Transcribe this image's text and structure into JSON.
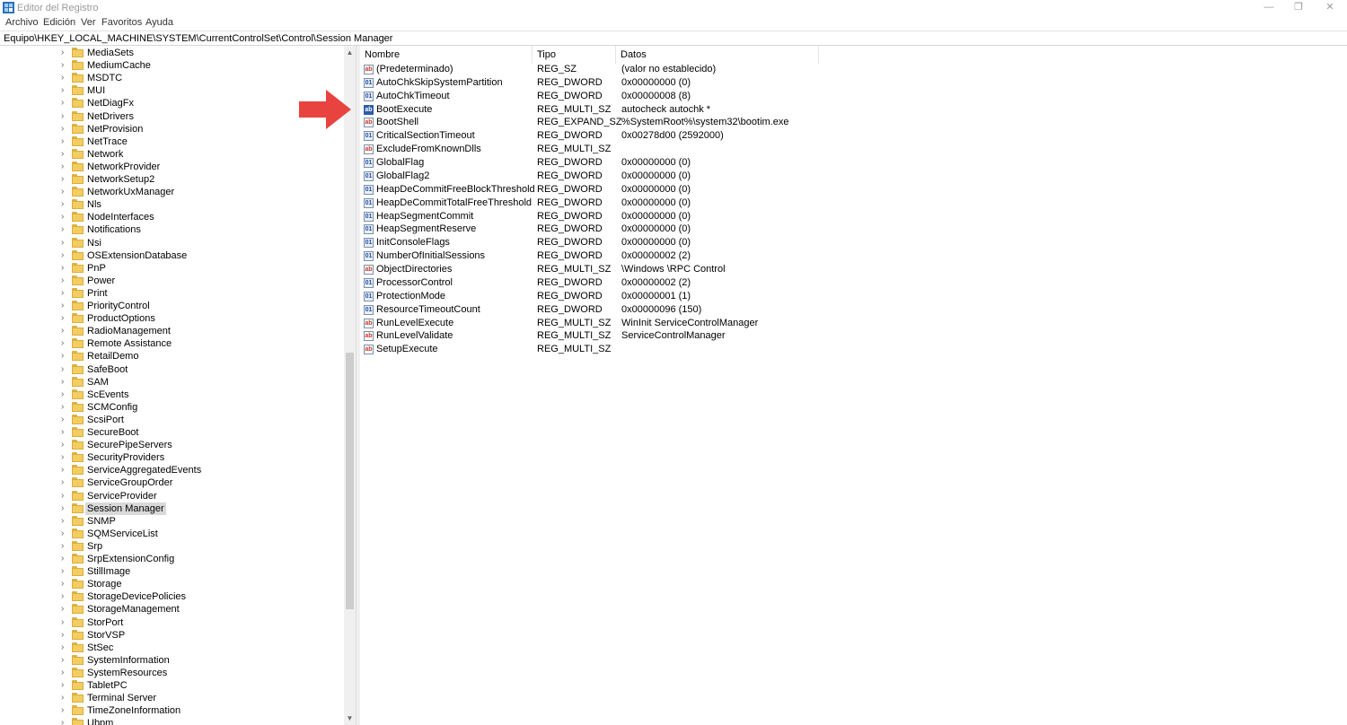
{
  "window": {
    "title": "Editor del Registro",
    "minimize_glyph": "—",
    "maximize_glyph": "❐",
    "close_glyph": "✕"
  },
  "menu": [
    "Archivo",
    "Edición",
    "Ver",
    "Favoritos",
    "Ayuda"
  ],
  "address": "Equipo\\HKEY_LOCAL_MACHINE\\SYSTEM\\CurrentControlSet\\Control\\Session Manager",
  "tree": {
    "selected": "Session Manager",
    "chevron_glyph": "›",
    "items": [
      "MediaSets",
      "MediumCache",
      "MSDTC",
      "MUI",
      "NetDiagFx",
      "NetDrivers",
      "NetProvision",
      "NetTrace",
      "Network",
      "NetworkProvider",
      "NetworkSetup2",
      "NetworkUxManager",
      "Nls",
      "NodeInterfaces",
      "Notifications",
      "Nsi",
      "OSExtensionDatabase",
      "PnP",
      "Power",
      "Print",
      "PriorityControl",
      "ProductOptions",
      "RadioManagement",
      "Remote Assistance",
      "RetailDemo",
      "SafeBoot",
      "SAM",
      "ScEvents",
      "SCMConfig",
      "ScsiPort",
      "SecureBoot",
      "SecurePipeServers",
      "SecurityProviders",
      "ServiceAggregatedEvents",
      "ServiceGroupOrder",
      "ServiceProvider",
      "Session Manager",
      "SNMP",
      "SQMServiceList",
      "Srp",
      "SrpExtensionConfig",
      "StillImage",
      "Storage",
      "StorageDevicePolicies",
      "StorageManagement",
      "StorPort",
      "StorVSP",
      "StSec",
      "SystemInformation",
      "SystemResources",
      "TabletPC",
      "Terminal Server",
      "TimeZoneInformation",
      "Ubpm"
    ]
  },
  "scrollbar": {
    "up_glyph": "▲",
    "down_glyph": "▼"
  },
  "list": {
    "headers": {
      "name": "Nombre",
      "type": "Tipo",
      "data": "Datos"
    },
    "selected": "BootExecute",
    "rows": [
      {
        "icon": "string-value-icon",
        "glyph": "ab",
        "name": "(Predeterminado)",
        "type": "REG_SZ",
        "data": "(valor no establecido)"
      },
      {
        "icon": "binary-value-icon",
        "glyph": "01",
        "name": "AutoChkSkipSystemPartition",
        "type": "REG_DWORD",
        "data": "0x00000000 (0)"
      },
      {
        "icon": "binary-value-icon",
        "glyph": "01",
        "name": "AutoChkTimeout",
        "type": "REG_DWORD",
        "data": "0x00000008 (8)"
      },
      {
        "icon": "string-value-icon",
        "glyph": "ab",
        "name": "BootExecute",
        "type": "REG_MULTI_SZ",
        "data": "autocheck autochk *"
      },
      {
        "icon": "string-value-icon",
        "glyph": "ab",
        "name": "BootShell",
        "type": "REG_EXPAND_SZ",
        "data": "%SystemRoot%\\system32\\bootim.exe"
      },
      {
        "icon": "binary-value-icon",
        "glyph": "01",
        "name": "CriticalSectionTimeout",
        "type": "REG_DWORD",
        "data": "0x00278d00 (2592000)"
      },
      {
        "icon": "string-value-icon",
        "glyph": "ab",
        "name": "ExcludeFromKnownDlls",
        "type": "REG_MULTI_SZ",
        "data": ""
      },
      {
        "icon": "binary-value-icon",
        "glyph": "01",
        "name": "GlobalFlag",
        "type": "REG_DWORD",
        "data": "0x00000000 (0)"
      },
      {
        "icon": "binary-value-icon",
        "glyph": "01",
        "name": "GlobalFlag2",
        "type": "REG_DWORD",
        "data": "0x00000000 (0)"
      },
      {
        "icon": "binary-value-icon",
        "glyph": "01",
        "name": "HeapDeCommitFreeBlockThreshold",
        "type": "REG_DWORD",
        "data": "0x00000000 (0)"
      },
      {
        "icon": "binary-value-icon",
        "glyph": "01",
        "name": "HeapDeCommitTotalFreeThreshold",
        "type": "REG_DWORD",
        "data": "0x00000000 (0)"
      },
      {
        "icon": "binary-value-icon",
        "glyph": "01",
        "name": "HeapSegmentCommit",
        "type": "REG_DWORD",
        "data": "0x00000000 (0)"
      },
      {
        "icon": "binary-value-icon",
        "glyph": "01",
        "name": "HeapSegmentReserve",
        "type": "REG_DWORD",
        "data": "0x00000000 (0)"
      },
      {
        "icon": "binary-value-icon",
        "glyph": "01",
        "name": "InitConsoleFlags",
        "type": "REG_DWORD",
        "data": "0x00000000 (0)"
      },
      {
        "icon": "binary-value-icon",
        "glyph": "01",
        "name": "NumberOfInitialSessions",
        "type": "REG_DWORD",
        "data": "0x00000002 (2)"
      },
      {
        "icon": "string-value-icon",
        "glyph": "ab",
        "name": "ObjectDirectories",
        "type": "REG_MULTI_SZ",
        "data": "\\Windows \\RPC Control"
      },
      {
        "icon": "binary-value-icon",
        "glyph": "01",
        "name": "ProcessorControl",
        "type": "REG_DWORD",
        "data": "0x00000002 (2)"
      },
      {
        "icon": "binary-value-icon",
        "glyph": "01",
        "name": "ProtectionMode",
        "type": "REG_DWORD",
        "data": "0x00000001 (1)"
      },
      {
        "icon": "binary-value-icon",
        "glyph": "01",
        "name": "ResourceTimeoutCount",
        "type": "REG_DWORD",
        "data": "0x00000096 (150)"
      },
      {
        "icon": "string-value-icon",
        "glyph": "ab",
        "name": "RunLevelExecute",
        "type": "REG_MULTI_SZ",
        "data": "WinInit ServiceControlManager"
      },
      {
        "icon": "string-value-icon",
        "glyph": "ab",
        "name": "RunLevelValidate",
        "type": "REG_MULTI_SZ",
        "data": "ServiceControlManager"
      },
      {
        "icon": "string-value-icon",
        "glyph": "ab",
        "name": "SetupExecute",
        "type": "REG_MULTI_SZ",
        "data": ""
      }
    ]
  },
  "annotation": {
    "arrow_color": "#e8433f",
    "icon": "red-arrow-icon"
  }
}
